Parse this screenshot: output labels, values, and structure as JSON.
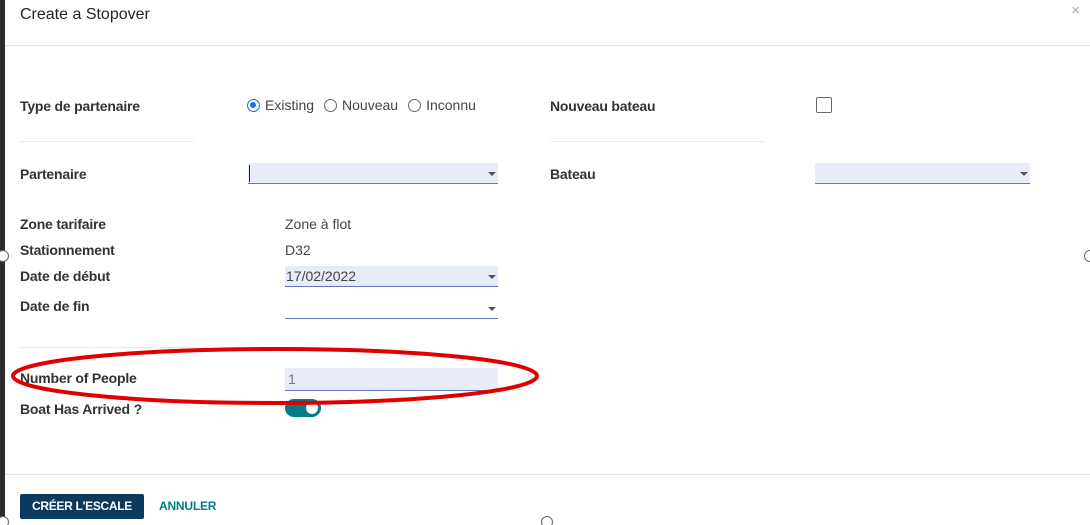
{
  "dialog": {
    "title": "Create a Stopover",
    "close_label": "×"
  },
  "form": {
    "partner_type": {
      "label": "Type de partenaire",
      "options": [
        {
          "label": "Existing",
          "checked": true
        },
        {
          "label": "Nouveau",
          "checked": false
        },
        {
          "label": "Inconnu",
          "checked": false
        }
      ]
    },
    "new_boat": {
      "label": "Nouveau bateau",
      "checked": false
    },
    "partner": {
      "label": "Partenaire",
      "value": ""
    },
    "boat": {
      "label": "Bateau",
      "value": ""
    },
    "tariff_zone": {
      "label": "Zone tarifaire",
      "value": "Zone à flot"
    },
    "parking": {
      "label": "Stationnement",
      "value": "D32"
    },
    "start_date": {
      "label": "Date de début",
      "value": "17/02/2022"
    },
    "end_date": {
      "label": "Date de fin",
      "value": ""
    },
    "people": {
      "label": "Number of People",
      "value": "1"
    },
    "boat_arrived": {
      "label": "Boat Has Arrived ?",
      "on": true
    }
  },
  "footer": {
    "create_label": "CRÉER L'ESCALE",
    "cancel_label": "ANNULER"
  },
  "colors": {
    "primary": "#0b3a5e",
    "accent": "#017e84",
    "radio": "#1a73e8",
    "annotation": "#e00000"
  }
}
